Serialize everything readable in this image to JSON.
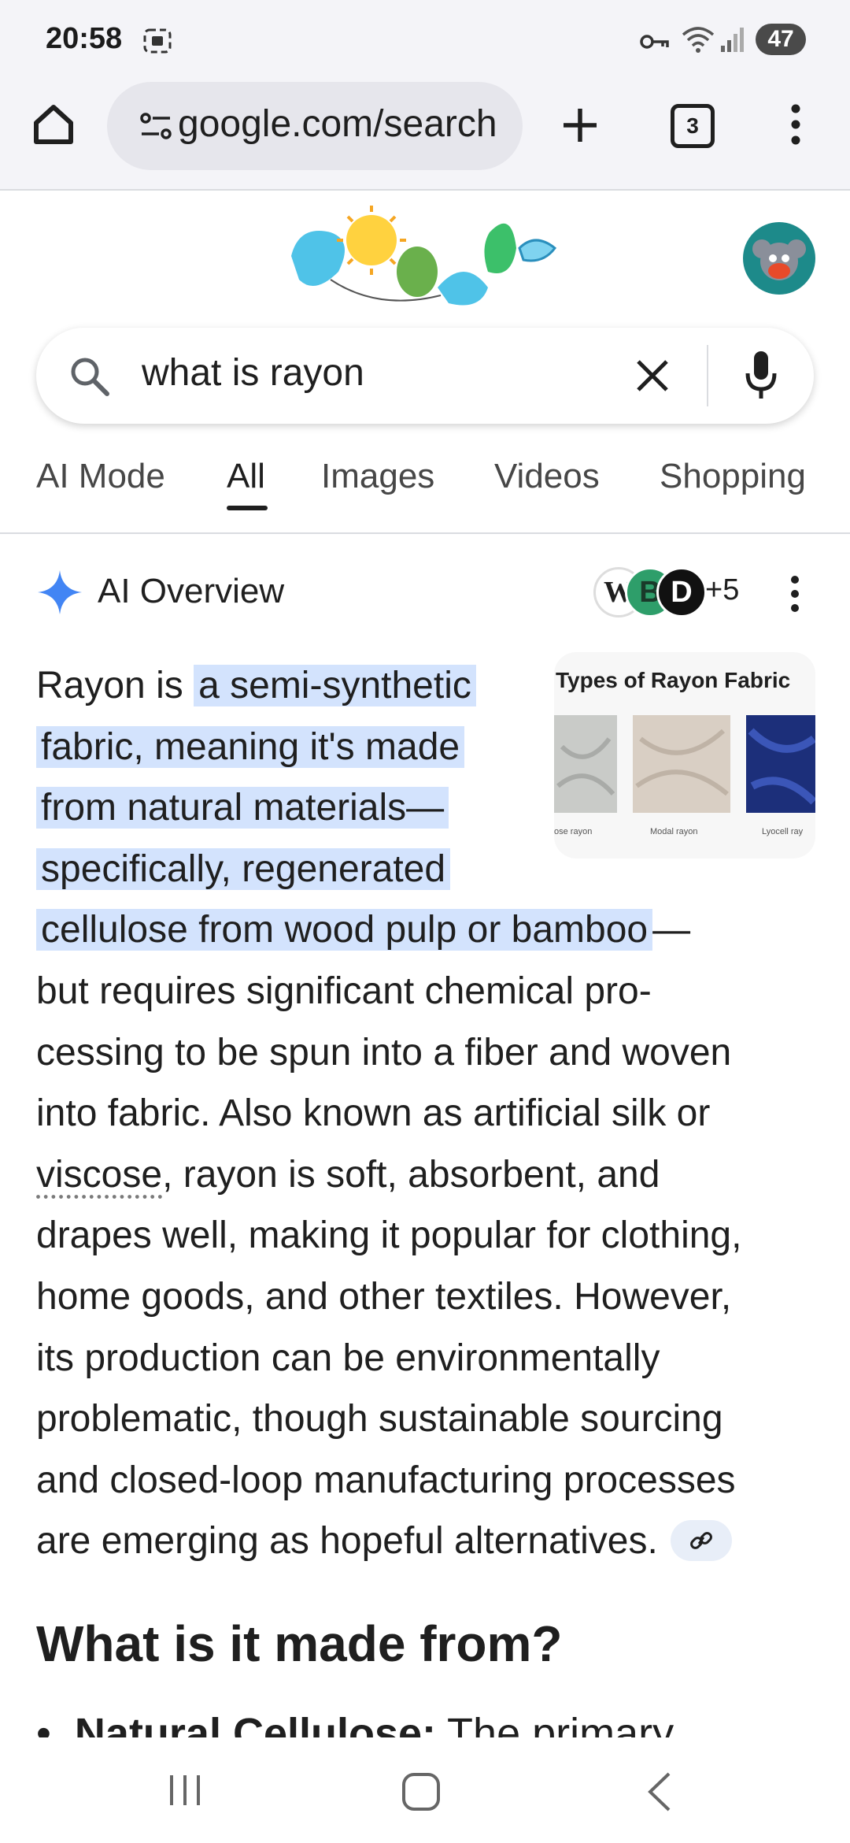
{
  "status_bar": {
    "time": "20:58",
    "battery": "47"
  },
  "browser": {
    "url": "google.com/search",
    "tab_count": "3"
  },
  "search": {
    "query": "what is rayon"
  },
  "tabs": [
    {
      "label": "AI Mode"
    },
    {
      "label": "All"
    },
    {
      "label": "Images"
    },
    {
      "label": "Videos"
    },
    {
      "label": "Shopping"
    }
  ],
  "ai_overview": {
    "header": "AI Overview",
    "sources_more": "+5",
    "image_title": "Types of Rayon Fabric",
    "image_captions": [
      "ose rayon",
      "Modal rayon",
      "Lyocell ray"
    ],
    "lines": {
      "l1a": "Rayon is ",
      "l1b": "a semi-synthetic",
      "l2": "fabric, meaning it's made",
      "l3": "from natural materials—",
      "l4": "specifically, regenerated",
      "l5a": "cellulose from wood pulp or bamboo",
      "l5b": "—",
      "l6": "but requires significant chemical pro-",
      "l7": "cessing to be spun into a fiber and woven",
      "l8": "into fabric. Also known as artificial silk or",
      "l9a": "viscose",
      "l9b": ", rayon is soft, absorbent, and",
      "l10": "drapes well, making it popular for clothing,",
      "l11": "home goods, and other textiles. However,",
      "l12": "its production can be environmentally",
      "l13": "problematic, though sustainable sourcing",
      "l14": "and closed-loop manufacturing processes",
      "l15": "are emerging as hopeful alternatives."
    },
    "section_heading": "What is it made from?",
    "bullet_bold": "Natural Cellulose:",
    "bullet_text": " The primary"
  },
  "colors": {
    "highlight": "#d3e3fd",
    "sparkle": "#4285f4",
    "status_bg": "#f4f4f8"
  },
  "icons": [
    "home-icon",
    "site-info-icon",
    "new-tab-icon",
    "tab-switcher-icon",
    "more-vert-icon",
    "search-icon",
    "clear-icon",
    "mic-icon",
    "sparkle-icon",
    "link-icon"
  ]
}
